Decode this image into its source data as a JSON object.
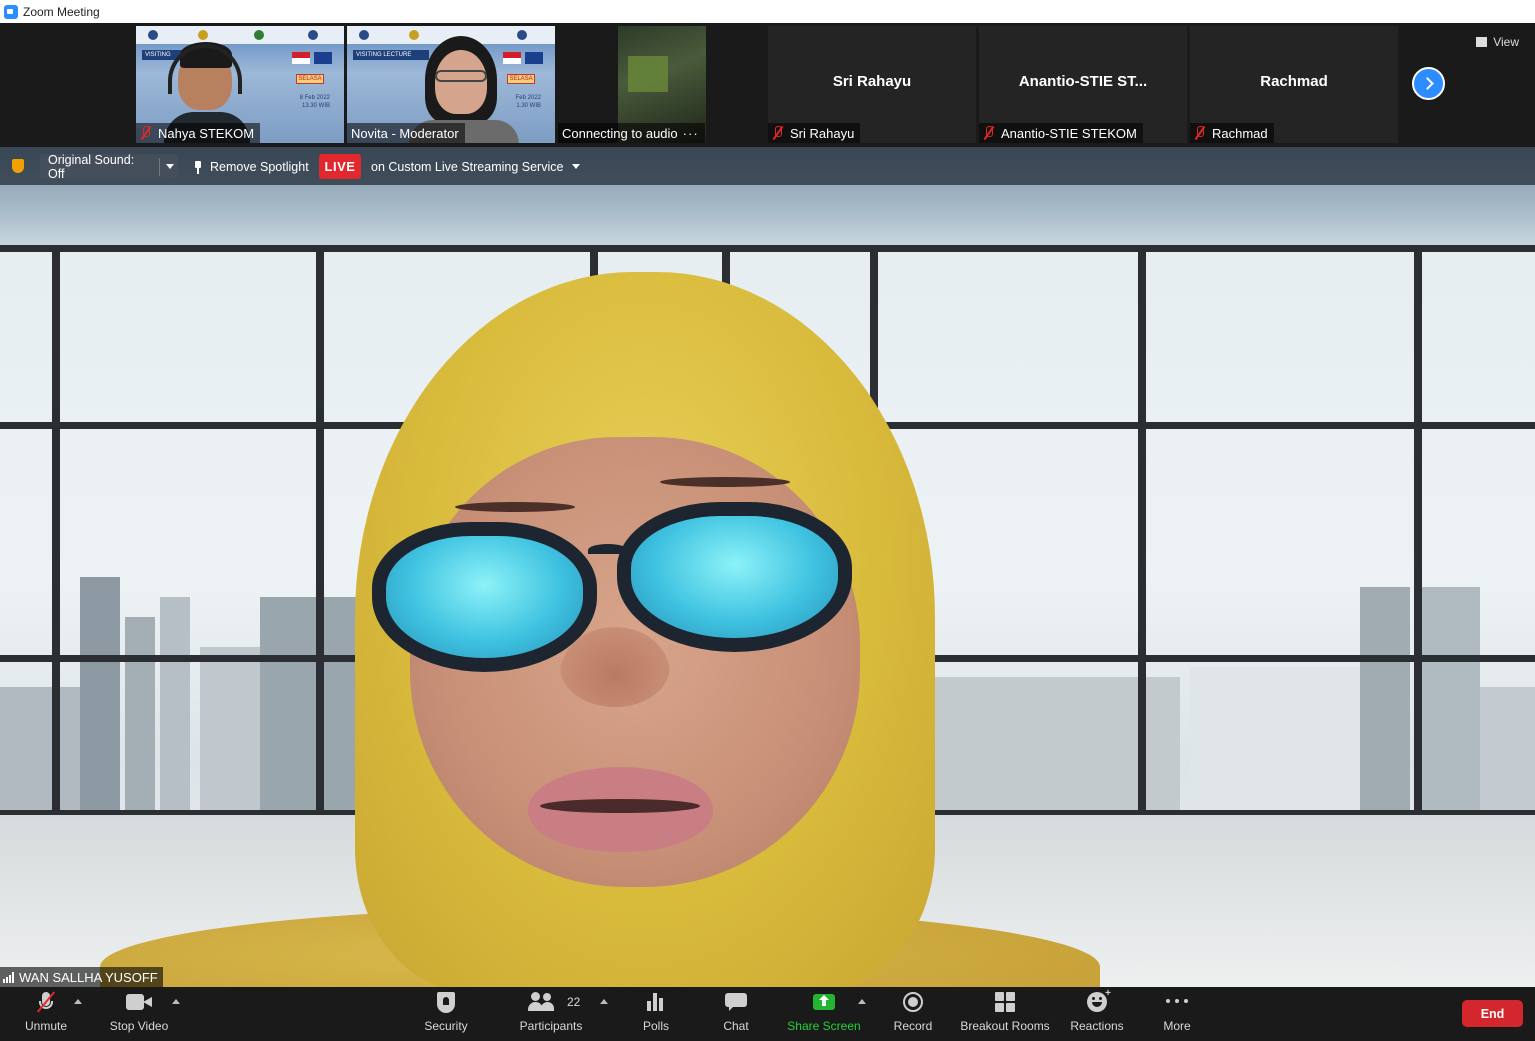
{
  "window": {
    "title": "Zoom Meeting"
  },
  "gallery": {
    "tiles": [
      {
        "name": "Nahya STEKOM",
        "banner": "VISITING",
        "day": "SELASA",
        "date": "8 Feb 2022",
        "time": "13.30 WIB"
      },
      {
        "name": "Novita - Moderator",
        "banner": "VISITING LECTURE",
        "day": "SELASA",
        "date": "Feb 2022",
        "time": "1.30 WIB"
      },
      {
        "name": "Connecting to audio"
      },
      {
        "name": "Sri Rahayu",
        "display": "Sri Rahayu"
      },
      {
        "name": "Anantio-STIE STEKOM",
        "display": "Anantio-STIE  ST..."
      },
      {
        "name": "Rachmad",
        "display": "Rachmad"
      }
    ],
    "view_label": "View",
    "next_icon": "chevron-right-icon"
  },
  "floating_toolbar": {
    "original_sound": "Original Sound: Off",
    "remove_spotlight": "Remove Spotlight",
    "live_badge": "LIVE",
    "live_destination": "on Custom Live Streaming Service",
    "accent_color": "#e0282e",
    "security_badge_color": "#f2a100"
  },
  "speaker": {
    "name": "WAN SALLHA YUSOFF"
  },
  "toolbar": {
    "unmute": "Unmute",
    "stop_video": "Stop Video",
    "security": "Security",
    "participants": "Participants",
    "participant_count": "22",
    "polls": "Polls",
    "chat": "Chat",
    "share_screen": "Share Screen",
    "record": "Record",
    "breakout_rooms": "Breakout Rooms",
    "reactions": "Reactions",
    "more": "More",
    "end": "End",
    "share_color": "#23b532",
    "end_color": "#d3262d"
  }
}
